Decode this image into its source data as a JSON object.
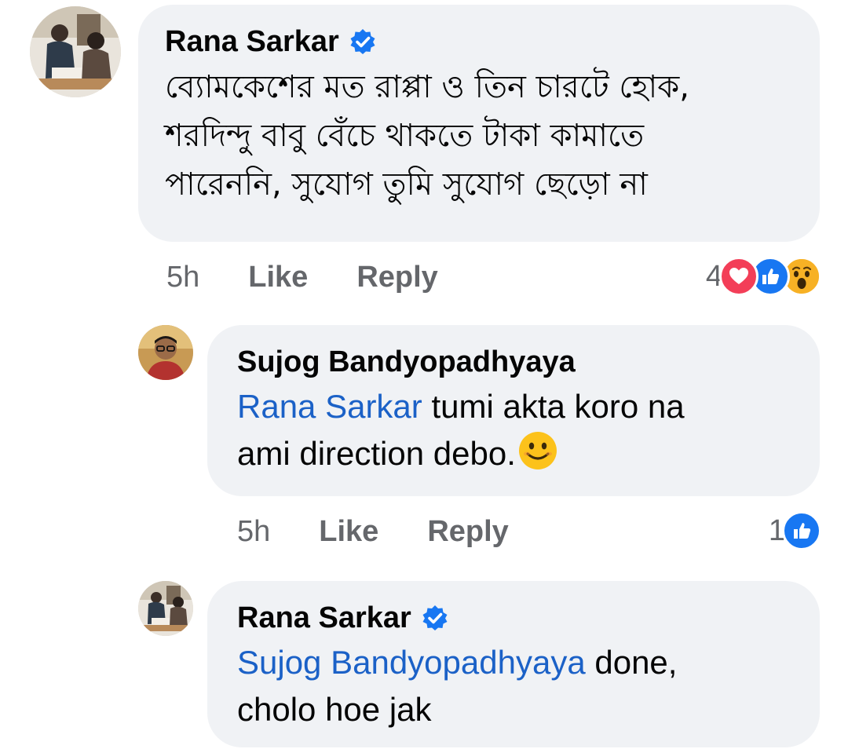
{
  "colors": {
    "bubble_bg": "#f0f2f5",
    "mention": "#1b61c7",
    "meta_text": "#65676b",
    "verified_blue": "#1877f2",
    "love_red": "#f33e58",
    "like_blue": "#1877f2",
    "wow_yellow": "#f7b125"
  },
  "comments": [
    {
      "author": "Rana Sarkar",
      "verified": true,
      "lines": [
        "ব্যোমকেশের মত রাপ্পা ও তিন চারটে হোক,",
        "শরদিন্দু বাবু বেঁচে থাকতে টাকা কামাতে",
        "পারেননি, সুযোগ তুমি সুযোগ ছেড়ো না"
      ],
      "time": "5h",
      "like_label": "Like",
      "reply_label": "Reply",
      "reaction_count": "4",
      "reactions": [
        "love-icon",
        "like-icon",
        "wow-icon"
      ]
    },
    {
      "author": "Sujog Bandyopadhyaya",
      "verified": false,
      "mention": "Rana Sarkar",
      "text_after_mention": " tumi akta koro na",
      "text_line2": "ami direction debo.",
      "emoji": "smiling-face-icon",
      "time": "5h",
      "like_label": "Like",
      "reply_label": "Reply",
      "reaction_count": "1",
      "reactions": [
        "like-icon"
      ]
    },
    {
      "author": "Rana Sarkar",
      "verified": true,
      "mention": "Sujog Bandyopadhyaya",
      "text_after_mention": " done,",
      "text_line2": "cholo hoe jak"
    }
  ]
}
